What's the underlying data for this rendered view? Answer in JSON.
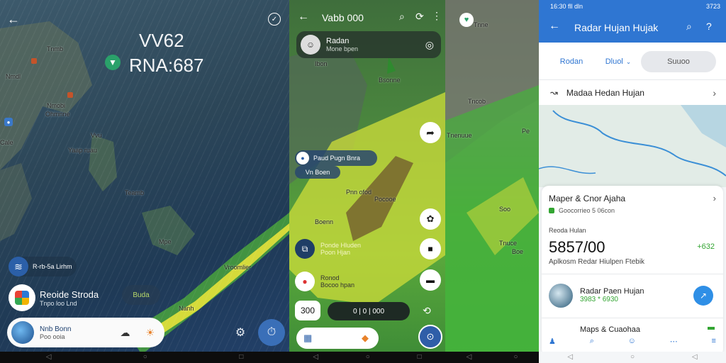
{
  "panel1": {
    "overlay_title": "VV62",
    "overlay_subtitle": "RNA:687",
    "map_labels": [
      "Tnmb",
      "Nmdl",
      "Nmobi",
      "Ohmnne",
      "Yaap ruau",
      "Teamb",
      "Mpe",
      "Cale",
      "Vroomlier",
      "Vvu",
      "Nanh"
    ],
    "status_text": "R-rb-5a Lirhm",
    "status_tile_label": "Reoide Stroda",
    "status_tile_sub": "Tnpo loo Lnd",
    "right_chip": "Buda",
    "bottom_card_title": "Nnb Bonn",
    "bottom_card_sub": "Poo ooia",
    "colors": {
      "accent": "#3a78c9",
      "rain_band": "#e6e23a"
    }
  },
  "panel2": {
    "title": "Vabb 000",
    "header_card_title": "Radan",
    "header_card_sub": "Mone bpen",
    "map_labels": [
      "Ibon",
      "Bsonne",
      "Pnn ofod",
      "Boenn",
      "Pocooe"
    ],
    "chip_a": "Paud Pugn Bnra",
    "chip_b": "Vn Boen",
    "list_items": [
      {
        "title": "Ponde Hluden",
        "sub": "Poon Hjan"
      },
      {
        "title": "Ronod",
        "sub": "Bocoo hpan"
      }
    ],
    "stepper_value": "300",
    "playback_label": "0 | 0 | 000",
    "time_marker": "1"
  },
  "panel3": {
    "map_labels": [
      "Tnne",
      "Tncob",
      "Tnenuue",
      "Pe",
      "Soo",
      "Tnuce",
      "Boe"
    ]
  },
  "panel4": {
    "status_time": "16:30 fll dln",
    "status_right": "3723",
    "title": "Radar Hujan Hujak",
    "tabs": [
      "Rodan",
      "Dluol",
      "Suuoo"
    ],
    "row_title": "Madaa Hedan Hujan",
    "section_title": "Maper & Cnor Ajaha",
    "section_sub": "Goocorrieo 5 06con",
    "stat_label": "Reoda Hulan",
    "stat_value": "5857/00",
    "stat_delta": "+632",
    "stat_caption": "Aplkosm Redar Hiulpen Ftebik",
    "app1_title": "Radar Paen Hujan",
    "app1_sub": "3983 * 6930",
    "app2_title": "Maps & Cuaohaa",
    "colors": {
      "accent": "#2f76d2",
      "positive": "#33a532"
    }
  }
}
